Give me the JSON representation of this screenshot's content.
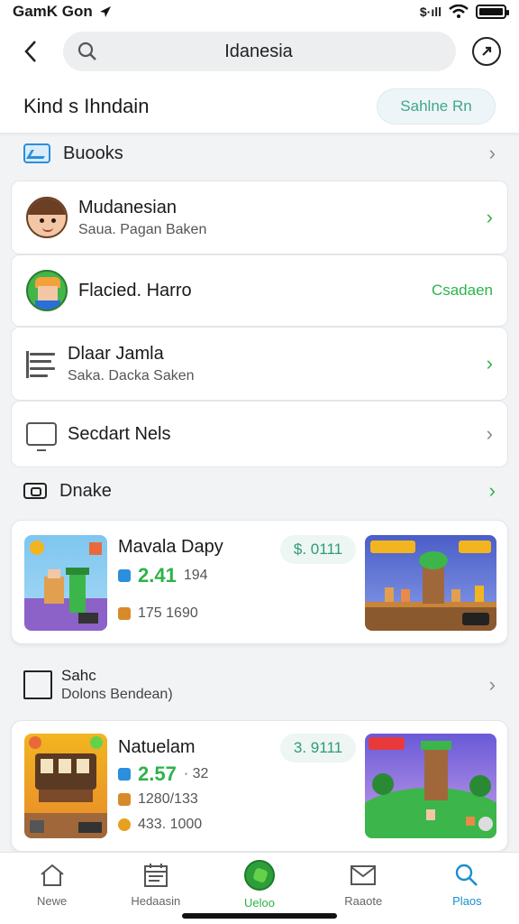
{
  "status_bar": {
    "carrier": "GamK Gon",
    "signal_text": "$·ıll"
  },
  "search": {
    "value": "Idanesia"
  },
  "header": {
    "title": "Kind s Ihndain",
    "action_label": "Sahlne Rn"
  },
  "sections": {
    "first": {
      "label": "Buooks"
    },
    "second": {
      "label": "Dnake"
    },
    "third": {
      "title": "Sahc",
      "subtitle": "Dolons Bendean)"
    }
  },
  "list_items": [
    {
      "title": "Mudanesian",
      "subtitle": "Saua. Pagan Baken",
      "icon": "avatar-face-icon"
    },
    {
      "title": "Flacied. Harro",
      "cta": "Csadaen",
      "icon": "avatar-game-icon"
    },
    {
      "title": "Dlaar Jamla",
      "subtitle": "Saka. Dacka Saken",
      "icon": "document-icon"
    },
    {
      "title": "Secdart Nels",
      "icon": "monitor-icon"
    }
  ],
  "games": [
    {
      "title": "Mavala Dapy",
      "price": "$. 0111",
      "stat1": "2.41",
      "stat1_extra": "194",
      "stat2": "175 1690"
    },
    {
      "title": "Natuelam",
      "price": "3. 9111",
      "stat1": "2.57",
      "stat1_extra": "· 32",
      "stat2": "1280/133",
      "stat3": "433. 1000"
    }
  ],
  "bottom_nav": [
    {
      "label": "Newe",
      "icon": "home-icon"
    },
    {
      "label": "Hedaasin",
      "icon": "calendar-icon"
    },
    {
      "label": "Ueloo",
      "icon": "game-icon"
    },
    {
      "label": "Raaote",
      "icon": "mail-icon"
    },
    {
      "label": "Plaos",
      "icon": "search-icon"
    }
  ],
  "colors": {
    "accent_green": "#2db34a",
    "accent_blue": "#1a8fd0",
    "pill_text": "#3da88a"
  }
}
